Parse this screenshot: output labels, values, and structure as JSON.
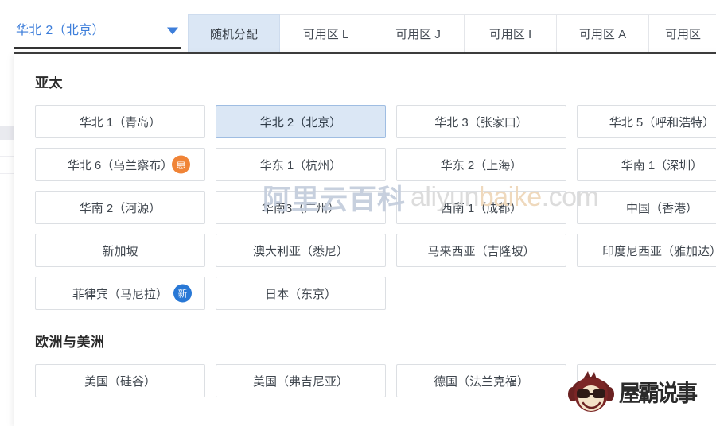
{
  "topbar": {
    "region_selector": {
      "name": "region-selector",
      "value": "华北 2（北京）",
      "caret_icon": "chevron-down-icon",
      "color": "#3d7eda"
    },
    "zone_tabs": [
      {
        "label": "随机分配",
        "selected": true
      },
      {
        "label": "可用区 L",
        "selected": false
      },
      {
        "label": "可用区 J",
        "selected": false
      },
      {
        "label": "可用区 I",
        "selected": false
      },
      {
        "label": "可用区 A",
        "selected": false
      },
      {
        "label": "可用区",
        "selected": false,
        "clipped": true
      }
    ]
  },
  "panel": {
    "groups": [
      {
        "title": "亚太",
        "items": [
          {
            "label": "华北 1（青岛）",
            "selected": false,
            "badge": null
          },
          {
            "label": "华北 2（北京）",
            "selected": true,
            "badge": null
          },
          {
            "label": "华北 3（张家口）",
            "selected": false,
            "badge": null
          },
          {
            "label": "华北 5（呼和浩特）",
            "selected": false,
            "badge": null
          },
          {
            "label": "华北 6（乌兰察布）",
            "selected": false,
            "badge": {
              "text": "惠",
              "kind": "hui",
              "color": "#f08437"
            }
          },
          {
            "label": "华东 1（杭州）",
            "selected": false,
            "badge": null
          },
          {
            "label": "华东 2（上海）",
            "selected": false,
            "badge": null
          },
          {
            "label": "华南 1（深圳）",
            "selected": false,
            "badge": null
          },
          {
            "label": "华南 2（河源）",
            "selected": false,
            "badge": null
          },
          {
            "label": "华南3（广州）",
            "selected": false,
            "badge": null
          },
          {
            "label": "西南 1（成都）",
            "selected": false,
            "badge": null
          },
          {
            "label": "中国（香港）",
            "selected": false,
            "badge": null
          },
          {
            "label": "新加坡",
            "selected": false,
            "badge": null
          },
          {
            "label": "澳大利亚（悉尼）",
            "selected": false,
            "badge": null
          },
          {
            "label": "马来西亚（吉隆坡）",
            "selected": false,
            "badge": null
          },
          {
            "label": "印度尼西亚（雅加达）",
            "selected": false,
            "badge": null
          },
          {
            "label": "菲律宾（马尼拉）",
            "selected": false,
            "badge": {
              "text": "新",
              "kind": "xin",
              "color": "#2878d6"
            }
          },
          {
            "label": "日本（东京）",
            "selected": false,
            "badge": null
          }
        ]
      },
      {
        "title": "欧洲与美洲",
        "items": [
          {
            "label": "美国（硅谷）",
            "selected": false,
            "badge": null
          },
          {
            "label": "美国（弗吉尼亚）",
            "selected": false,
            "badge": null
          },
          {
            "label": "德国（法兰克福）",
            "selected": false,
            "badge": null
          },
          {
            "label": "",
            "selected": false,
            "badge": null
          }
        ]
      }
    ]
  },
  "watermarks": {
    "text_cn": "阿里云百科",
    "text_en_a": "aliyun",
    "text_en_b": "baike",
    "text_en_c": ".com",
    "logo_text": "屋霸说事",
    "logo_icon": "monkey-face-with-sunglasses-icon"
  }
}
